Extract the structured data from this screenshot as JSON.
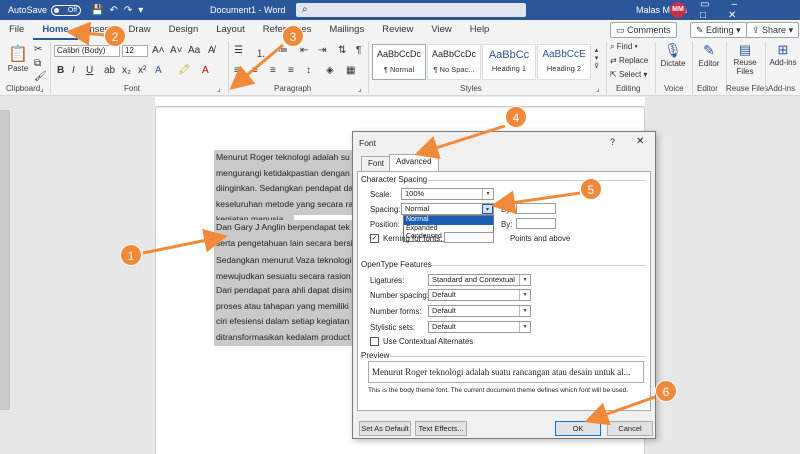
{
  "titlebar": {
    "autosave_label": "AutoSave",
    "autosave_state": "Off",
    "doc_title": "Document1 - Word",
    "user_name": "Malas Media",
    "user_initials": "MM"
  },
  "tabs": [
    "File",
    "Home",
    "Insert",
    "Draw",
    "Design",
    "Layout",
    "References",
    "Mailings",
    "Review",
    "View",
    "Help"
  ],
  "tab_buttons": {
    "comments": "Comments",
    "editing": "Editing",
    "share": "Share"
  },
  "ribbon": {
    "clipboard": {
      "paste": "Paste",
      "label": "Clipboard"
    },
    "font": {
      "family": "Calibri (Body)",
      "size": "12",
      "label": "Font"
    },
    "paragraph": {
      "label": "Paragraph"
    },
    "styles": {
      "label": "Styles",
      "items": [
        {
          "sample": "AaBbCcDc",
          "name": "¶ Normal"
        },
        {
          "sample": "AaBbCcDc",
          "name": "¶ No Spac..."
        },
        {
          "sample": "AaBbCc",
          "name": "Heading 1"
        },
        {
          "sample": "AaBbCcE",
          "name": "Heading 2"
        }
      ]
    },
    "editing": {
      "find": "Find",
      "replace": "Replace",
      "select": "Select",
      "label": "Editing"
    },
    "voice": {
      "dictate": "Dictate",
      "label": "Voice"
    },
    "editor": {
      "editor": "Editor",
      "label": "Editor"
    },
    "reuse": {
      "reuse": "Reuse Files",
      "label": "Reuse Files"
    },
    "addins": {
      "addins": "Add-ins",
      "label": "Add-ins"
    }
  },
  "document": {
    "paragraphs": [
      [
        "Menurut Roger teknologi adalah su",
        "mengurangi ketidakpastian dengan",
        "diinginkan. Sedangkan pendapat da",
        "keseluruhan metode yang secara ra",
        "kegiatan manusia."
      ],
      [
        "Dan Gary J Anglin berpendapat tek",
        "serta pengetahuan lain secara bersi"
      ],
      [
        "Sedangkan menurut Vaza teknologi",
        "mewujudkan sesuatu secara rasion"
      ],
      [
        "Dari pendapat para ahli dapat disim",
        "proses atau tahapan yang memiliki",
        "ciri efesiensi dalam setiap kegiatan",
        "ditransformasikan kedalam product"
      ]
    ]
  },
  "dialog": {
    "title": "Font",
    "help": "?",
    "close": "✕",
    "tabs": [
      "Font",
      "Advanced"
    ],
    "character_spacing": {
      "section": "Character Spacing",
      "scale_label": "Scale:",
      "scale_value": "100%",
      "spacing_label": "Spacing:",
      "spacing_value": "Normal",
      "spacing_options": [
        "Normal",
        "Expanded",
        "Condensed"
      ],
      "by_label": "By:",
      "position_label": "Position:",
      "position_by_label": "By:",
      "kerning_label": "Kerning for fonts:",
      "kerning_suffix": "Points and above"
    },
    "opentype": {
      "section": "OpenType Features",
      "ligatures_label": "Ligatures:",
      "ligatures_value": "Standard and Contextual",
      "number_spacing_label": "Number spacing:",
      "number_spacing_value": "Default",
      "number_forms_label": "Number forms:",
      "number_forms_value": "Default",
      "stylistic_sets_label": "Stylistic sets:",
      "stylistic_sets_value": "Default",
      "contextual_alternates_label": "Use Contextual Alternates"
    },
    "preview": {
      "section": "Preview",
      "text": "Menurut Roger teknologi adalah suatu rancangan atau desain untuk al...",
      "note": "This is the body theme font. The current document theme defines which font will be used."
    },
    "buttons": {
      "set_default": "Set As Default",
      "text_effects": "Text Effects...",
      "ok": "OK",
      "cancel": "Cancel"
    }
  },
  "callouts": [
    "1",
    "2",
    "3",
    "4",
    "5",
    "6"
  ],
  "colors": {
    "accent": "#2b579a",
    "callout": "#f08a3a",
    "selection": "#c9c9c9"
  }
}
